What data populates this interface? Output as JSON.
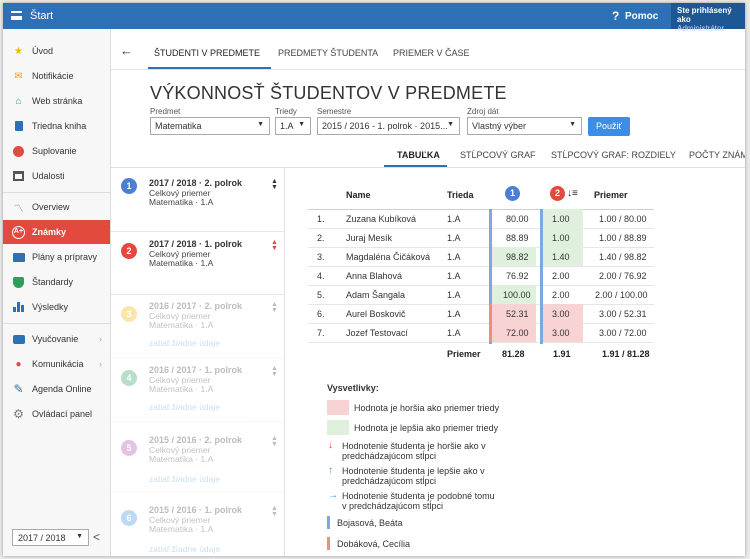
{
  "header": {
    "menu_icon": "hamburger-icon",
    "title": "Štart",
    "help_icon": "?",
    "help_label": "Pomoc",
    "user_line1": "Ste prihlásený ako",
    "user_line2": "Administrátor"
  },
  "sidebar": {
    "items": [
      {
        "label": "Úvod",
        "icon": "star-icon",
        "color": "#f5b400"
      },
      {
        "label": "Notifikácie",
        "icon": "envelope-icon",
        "color": "#f0a030"
      },
      {
        "label": "Web stránka",
        "icon": "home-icon",
        "color": "#2e9e5b"
      },
      {
        "label": "Triedna kniha",
        "icon": "book-icon",
        "color": "#2e70b5"
      },
      {
        "label": "Suplovanie",
        "icon": "person-icon",
        "color": "#e2493f"
      },
      {
        "label": "Udalosti",
        "icon": "calendar-icon",
        "color": "#555555"
      },
      {
        "label": "Overview",
        "icon": "chart-line-icon",
        "color": "#8c6bc8"
      },
      {
        "label": "Známky",
        "icon": "grade-icon",
        "color": "#ffffff"
      },
      {
        "label": "Plány a prípravy",
        "icon": "briefcase-icon",
        "color": "#2e70b5"
      },
      {
        "label": "Štandardy",
        "icon": "shield-icon",
        "color": "#2e9e5b"
      },
      {
        "label": "Výsledky",
        "icon": "bar-chart-icon",
        "color": "#2e70b5"
      },
      {
        "label": "Vyučovanie",
        "icon": "school-icon",
        "color": "#2e70b5"
      },
      {
        "label": "Komunikácia",
        "icon": "chat-icon",
        "color": "#e2493f"
      },
      {
        "label": "Agenda Online",
        "icon": "pen-icon",
        "color": "#2e70b5"
      },
      {
        "label": "Ovládací panel",
        "icon": "gear-icon",
        "color": "#777777"
      }
    ],
    "year": "2017 / 2018",
    "collapse": "<"
  },
  "tabs": [
    "ŠTUDENTI V PREDMETE",
    "PREDMETY ŠTUDENTA",
    "PRIEMER V ČASE"
  ],
  "page_title": "VÝKONNOSŤ ŠTUDENTOV V PREDMETE",
  "filters": {
    "subject_label": "Predmet",
    "subject_value": "Matematika",
    "class_label": "Triedy",
    "class_value": "1.A",
    "semester_label": "Semestre",
    "semester_value": "2015 / 2016 - 1. polrok · 2015...",
    "source_label": "Zdroj dát",
    "source_value": "Vlastný výber",
    "button": "Použiť"
  },
  "view_tabs": [
    "TABUĽKA",
    "STĹPCOVÝ GRAF",
    "STĹPCOVÝ GRAF: ROZDIELY",
    "POČTY ZNÁM"
  ],
  "semesters": [
    {
      "num": "1",
      "color": "#4a7fd4",
      "title": "2017 / 2018 · 2. polrok",
      "sub": "Celkový priemer",
      "cls": "Matematika · 1.A",
      "empty": ""
    },
    {
      "num": "2",
      "color": "#e2493f",
      "title": "2017 / 2018 · 1. polrok",
      "sub": "Celkový priemer",
      "cls": "Matematika · 1.A",
      "empty": ""
    },
    {
      "num": "3",
      "color": "#f5b400",
      "title": "2016 / 2017 · 2. polrok",
      "sub": "Celkový priemer",
      "cls": "Matematika · 1.A",
      "empty": "zatiaľ žiadne údaje"
    },
    {
      "num": "4",
      "color": "#2e9e5b",
      "title": "2016 / 2017 · 1. polrok",
      "sub": "Celkový priemer",
      "cls": "Matematika · 1.A",
      "empty": "zatiaľ žiadne údaje"
    },
    {
      "num": "5",
      "color": "#b04aaf",
      "title": "2015 / 2016 · 2. polrok",
      "sub": "Celkový priemer",
      "cls": "Matematika · 1.A",
      "empty": "zatiaľ žiadne údaje"
    },
    {
      "num": "6",
      "color": "#3a8ee6",
      "title": "2015 / 2016 · 1. polrok",
      "sub": "Celkový priemer",
      "cls": "Matematika · 1.A",
      "empty": "zatiaľ žiadne údaje"
    }
  ],
  "table": {
    "headers": {
      "name": "Name",
      "class": "Trieda",
      "c1": "1",
      "c2": "2",
      "avg": "Priemer"
    },
    "rows": [
      {
        "n": "1.",
        "name": "Zuzana Kubíková",
        "cls": "1.A",
        "v1": "80.00",
        "v2": "1.00",
        "avg": "1.00 / 80.00",
        "c1": "",
        "c2": "#dff1dc"
      },
      {
        "n": "2.",
        "name": "Juraj Mesík",
        "cls": "1.A",
        "v1": "88.89",
        "v2": "1.00",
        "avg": "1.00 / 88.89",
        "c1": "",
        "c2": "#dff1dc"
      },
      {
        "n": "3.",
        "name": "Magdaléna Čičáková",
        "cls": "1.A",
        "v1": "98.82",
        "v2": "1.40",
        "avg": "1.40 / 98.82",
        "c1": "#dff1dc",
        "c2": "#dff1dc"
      },
      {
        "n": "4.",
        "name": "Anna Blahová",
        "cls": "1.A",
        "v1": "76.92",
        "v2": "2.00",
        "avg": "2.00 / 76.92",
        "c1": "",
        "c2": ""
      },
      {
        "n": "5.",
        "name": "Adam Šangala",
        "cls": "1.A",
        "v1": "100.00",
        "v2": "2.00",
        "avg": "2.00 / 100.00",
        "c1": "#dff1dc",
        "c2": ""
      },
      {
        "n": "6.",
        "name": "Aurel Boskovič",
        "cls": "1.A",
        "v1": "52.31",
        "v2": "3.00",
        "avg": "3.00 / 52.31",
        "c1": "#f8d3d3",
        "c2": "#f8d3d3"
      },
      {
        "n": "7.",
        "name": "Jozef Testovací",
        "cls": "1.A",
        "v1": "72.00",
        "v2": "3.00",
        "avg": "3.00 / 72.00",
        "c1": "#f8d3d3",
        "c2": "#f8d3d3"
      }
    ],
    "footer": {
      "label": "Priemer",
      "v1": "81.28",
      "v2": "1.91",
      "avg": "1.91 / 81.28"
    }
  },
  "legend": {
    "title": "Vysvetlivky:",
    "worse": "Hodnota je horšia ako priemer triedy",
    "better": "Hodnota je lepšia ako priemer triedy",
    "down_1": "Hodnotenie študenta je horšie ako v",
    "down_2": "predchádzajúcom stĺpci",
    "up_1": "Hodnotenie študenta je lepšie ako v",
    "up_2": "predchádzajúcom stĺpci",
    "same_1": "Hodnotenie študenta je podobné tomu",
    "same_2": "v predchádzajúcom stĺpci",
    "teacher1": "Bojasová, Beáta",
    "teacher2": "Dobáková, Cecília"
  },
  "colors": {
    "primary": "#2e70b5",
    "active": "#e2493f",
    "worse": "#f8d3d3",
    "better": "#dff1dc",
    "teacher1": "#7ea6e0",
    "teacher2": "#ef8c7c"
  }
}
